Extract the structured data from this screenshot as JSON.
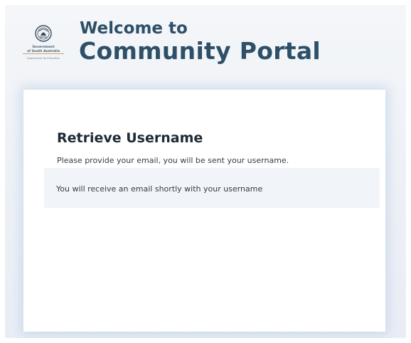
{
  "header": {
    "logo": {
      "icon": "government-crest-icon",
      "line1": "Government",
      "line2": "of South Australia",
      "line3": "Department for Education"
    },
    "welcome": "Welcome to",
    "portal": "Community Portal"
  },
  "card": {
    "title": "Retrieve Username",
    "subtitle": "Please provide your email, you will be sent your username.",
    "message": "You will receive an email shortly with your username"
  },
  "colors": {
    "heading": "#2d5068",
    "card_title": "#1e2a36",
    "background": "#eef2f7",
    "message_box": "#f1f4f8"
  }
}
